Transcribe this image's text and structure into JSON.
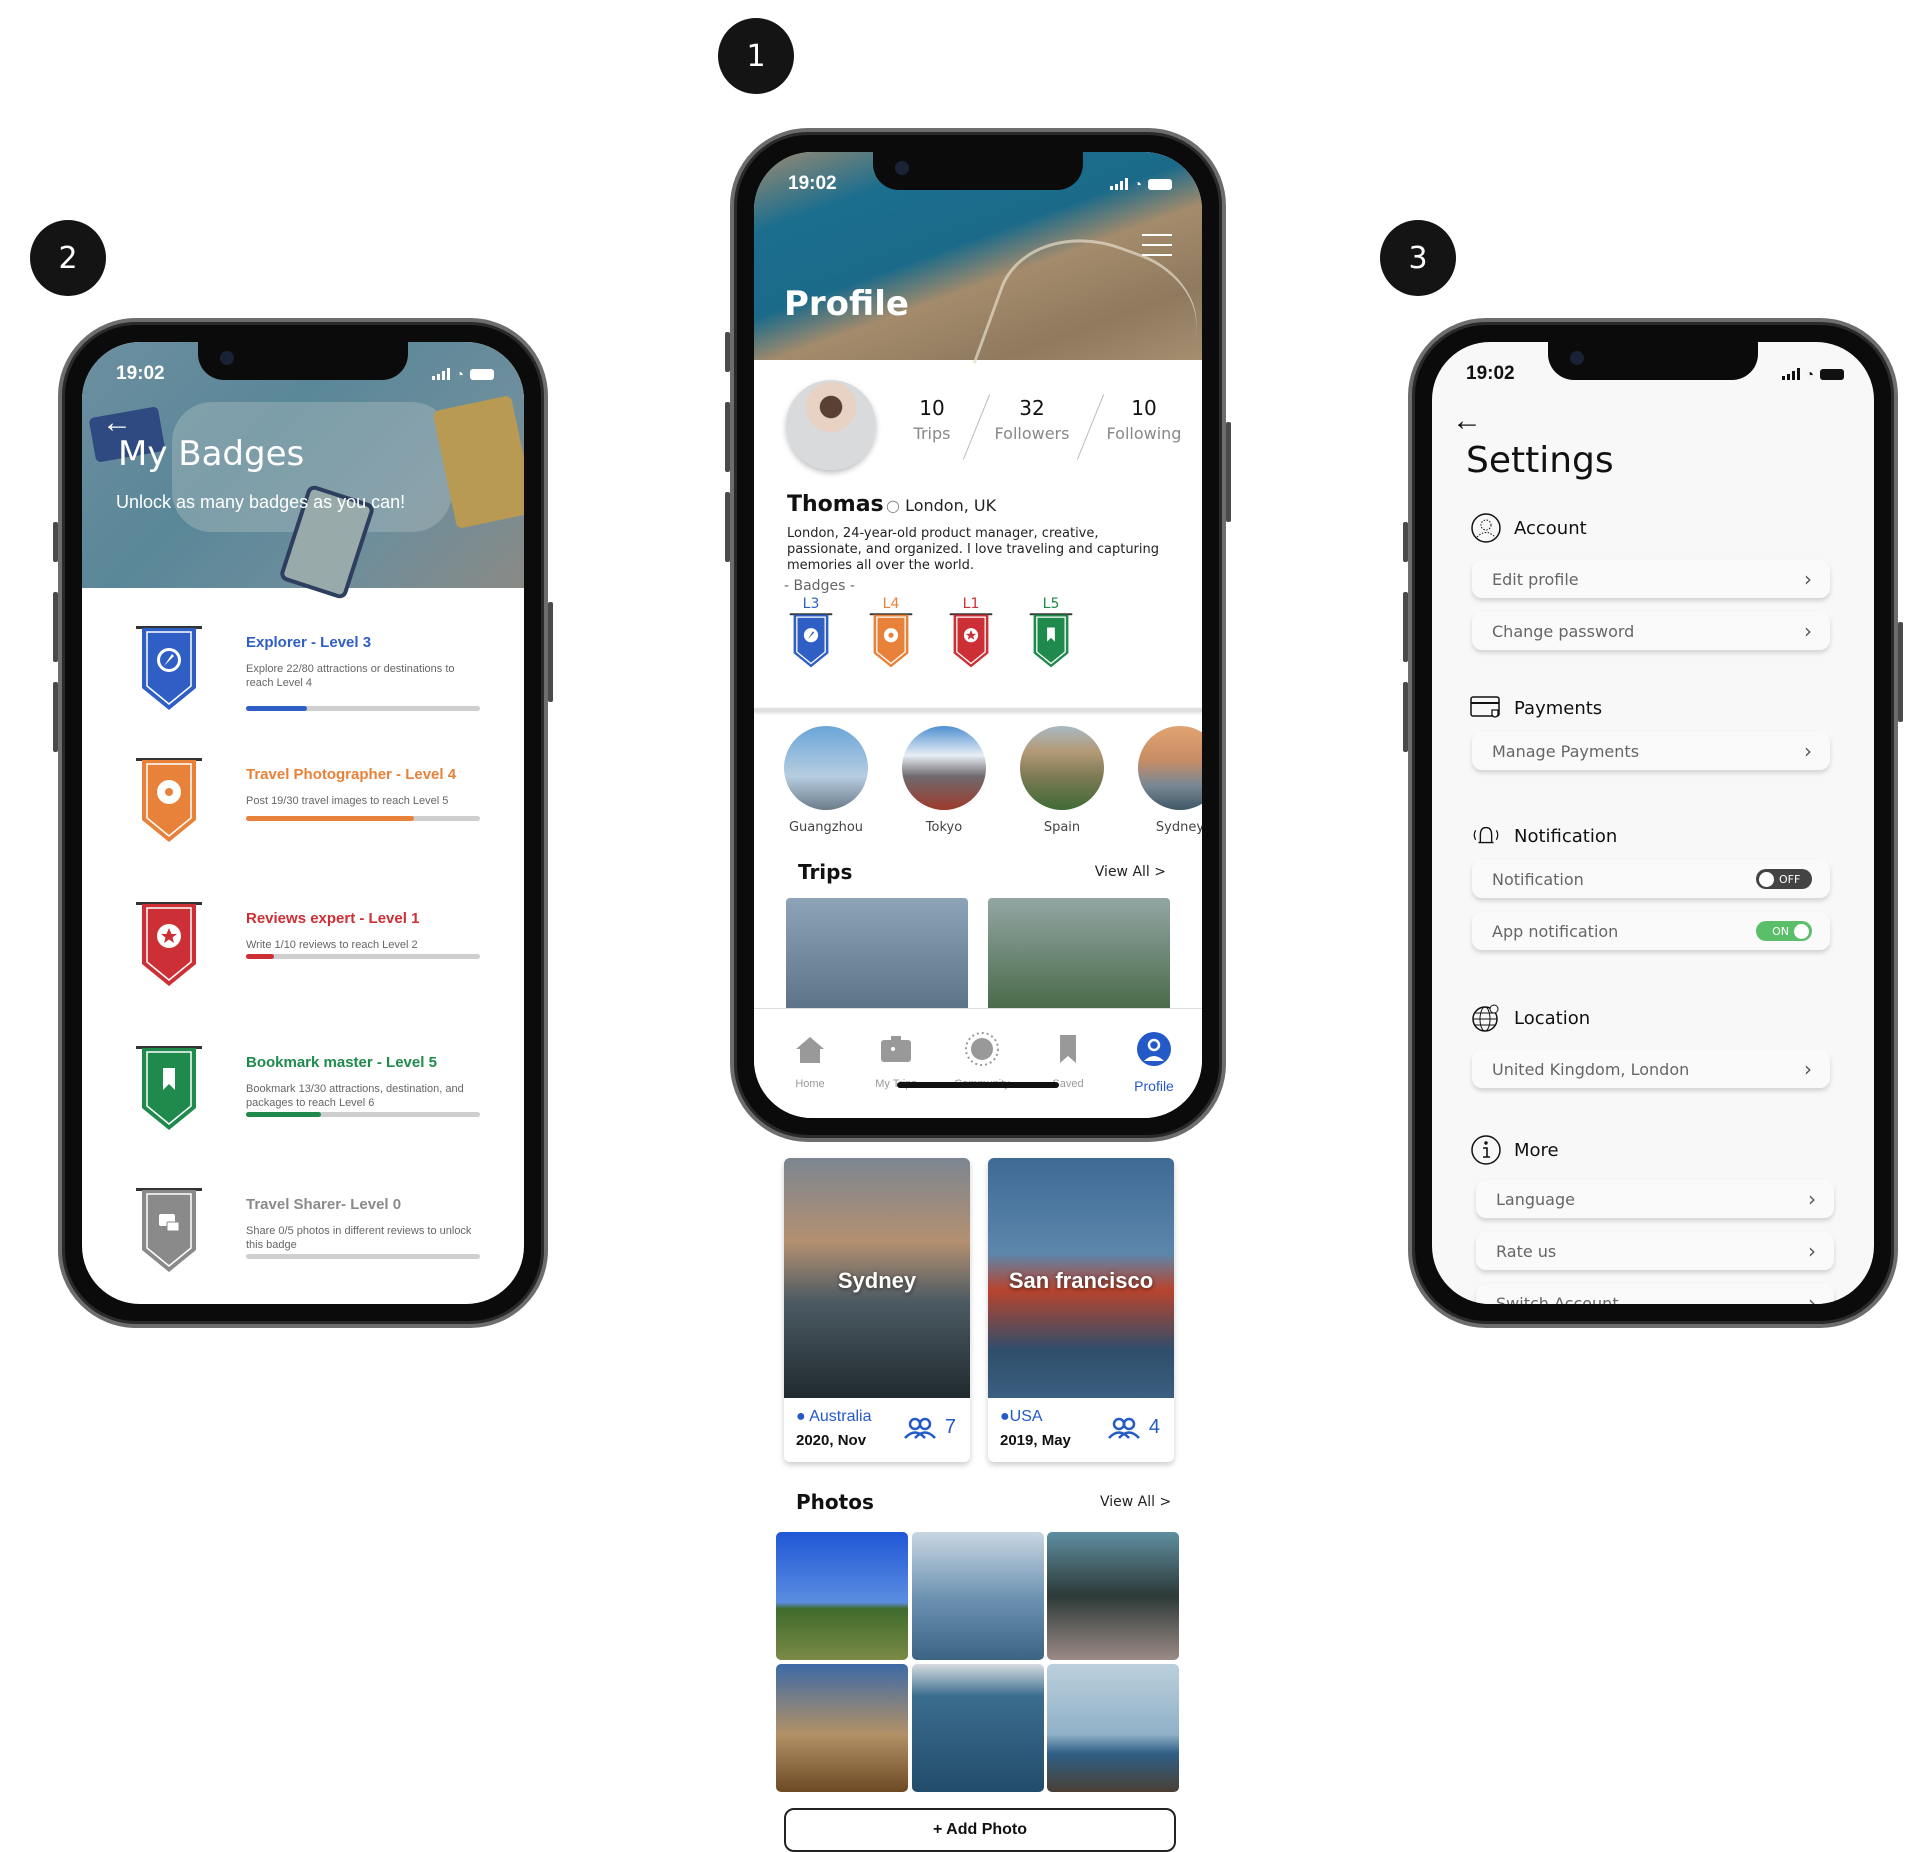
{
  "steps": [
    "1",
    "2",
    "3"
  ],
  "status_bar": {
    "time": "19:02"
  },
  "badges_screen": {
    "title": "My Badges",
    "subtitle": "Unlock as many badges as you can!",
    "back_icon": "arrow-left-icon",
    "badges": [
      {
        "title": "Explorer - Level 3",
        "description": "Explore 22/80 attractions or destinations to reach Level 4",
        "icon": "compass-icon",
        "color": "#2f5fc4",
        "progress": 0.26
      },
      {
        "title": "Travel Photographer - Level 4",
        "description": "Post 19/30 travel images to reach Level 5",
        "icon": "camera-aperture-icon",
        "color": "#e8823a",
        "progress": 0.72
      },
      {
        "title": "Reviews expert - Level 1",
        "description": "Write 1/10 reviews to reach Level 2",
        "icon": "star-icon",
        "color": "#cc2f35",
        "progress": 0.12
      },
      {
        "title": "Bookmark master - Level 5",
        "description": "Bookmark 13/30 attractions, destination, and packages to reach Level 6",
        "icon": "bookmark-icon",
        "color": "#1f8a4c",
        "progress": 0.32
      },
      {
        "title": "Travel Sharer- Level 0",
        "description": "Share 0/5 photos in different reviews to unlock this badge",
        "icon": "photos-icon",
        "color": "#8a8a8a",
        "progress": 0.0
      }
    ]
  },
  "profile_screen": {
    "title": "Profile",
    "menu_icon": "hamburger-menu-icon",
    "user": {
      "name": "Thomas",
      "location": "London, UK",
      "bio": "London, 24-year-old product manager, creative, passionate, and organized. I love traveling and capturing memories all over the world."
    },
    "stats": [
      {
        "value": "10",
        "label": "Trips"
      },
      {
        "value": "32",
        "label": "Followers"
      },
      {
        "value": "10",
        "label": "Following"
      }
    ],
    "badges_label": "- Badges -",
    "mini_badges": [
      {
        "level": "L3",
        "color": "#2f5fc4"
      },
      {
        "level": "L4",
        "color": "#e8823a"
      },
      {
        "level": "L1",
        "color": "#cc2f35"
      },
      {
        "level": "L5",
        "color": "#1f8a4c"
      }
    ],
    "destinations": [
      "Guangzhou",
      "Tokyo",
      "Spain",
      "Sydney"
    ],
    "trips_title": "Trips",
    "trips_view_all": "View All >",
    "trips": [
      {
        "city": "Sydney",
        "country": "Australia",
        "date": "2020, Nov",
        "people": "7"
      },
      {
        "city": "San francisco",
        "country": "USA",
        "date": "2019, May",
        "people": "4"
      }
    ],
    "photos_title": "Photos",
    "photos_view_all": "View All >",
    "add_photo": "+ Add Photo",
    "tabs": [
      {
        "label": "Home",
        "icon": "home-icon"
      },
      {
        "label": "My Trips",
        "icon": "suitcase-icon"
      },
      {
        "label": "Community",
        "icon": "globe-icon"
      },
      {
        "label": "Saved",
        "icon": "bookmark-icon"
      },
      {
        "label": "Profile",
        "icon": "profile-icon",
        "active": true
      }
    ],
    "accent": "#2459c8"
  },
  "settings_screen": {
    "title": "Settings",
    "groups": {
      "account": {
        "label": "Account",
        "items": [
          "Edit profile",
          "Change password"
        ]
      },
      "payments": {
        "label": "Payments",
        "items": [
          "Manage Payments"
        ]
      },
      "notification": {
        "label": "Notification",
        "items": [
          {
            "label": "Notification",
            "toggle": "OFF"
          },
          {
            "label": "App notification",
            "toggle": "ON"
          }
        ]
      },
      "location": {
        "label": "Location",
        "items": [
          "United Kingdom, London"
        ]
      },
      "more": {
        "label": "More",
        "items": [
          "Language",
          "Rate us",
          "Switch Account"
        ]
      }
    }
  }
}
